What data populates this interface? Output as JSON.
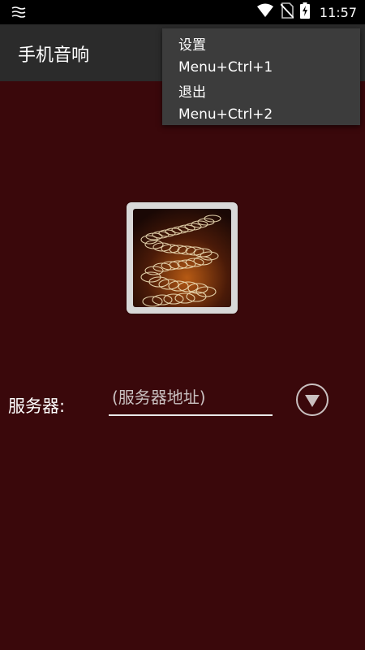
{
  "status_bar": {
    "time": "11:57",
    "icons": [
      "notification-icon",
      "wifi-icon",
      "no-sim-icon",
      "battery-charging-icon"
    ]
  },
  "app_bar": {
    "title": "手机音响"
  },
  "menu": {
    "items": [
      {
        "title": "设置",
        "shortcut": "Menu+Ctrl+1"
      },
      {
        "title": "退出",
        "shortcut": "Menu+Ctrl+2"
      }
    ]
  },
  "server": {
    "label": "服务器:",
    "placeholder": "(服务器地址)",
    "dropdown_icon": "dropdown-triangle-icon"
  },
  "colors": {
    "background": "#3a080b",
    "app_bar": "#2b2b2b",
    "menu": "#3c3c3c",
    "status_bar": "#000000",
    "text": "#ffffff"
  }
}
